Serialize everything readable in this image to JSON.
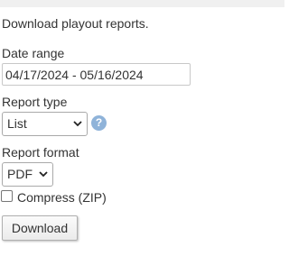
{
  "intro": "Download playout reports.",
  "date_range": {
    "label": "Date range",
    "value": "04/17/2024 - 05/16/2024"
  },
  "report_type": {
    "label": "Report type",
    "selected": "List",
    "help_symbol": "?"
  },
  "report_format": {
    "label": "Report format",
    "selected": "PDF"
  },
  "compress": {
    "label": "Compress (ZIP)",
    "checked": false
  },
  "download_button": {
    "label": "Download"
  },
  "colors": {
    "help_icon": "#8fb3d9",
    "text": "#333333"
  }
}
